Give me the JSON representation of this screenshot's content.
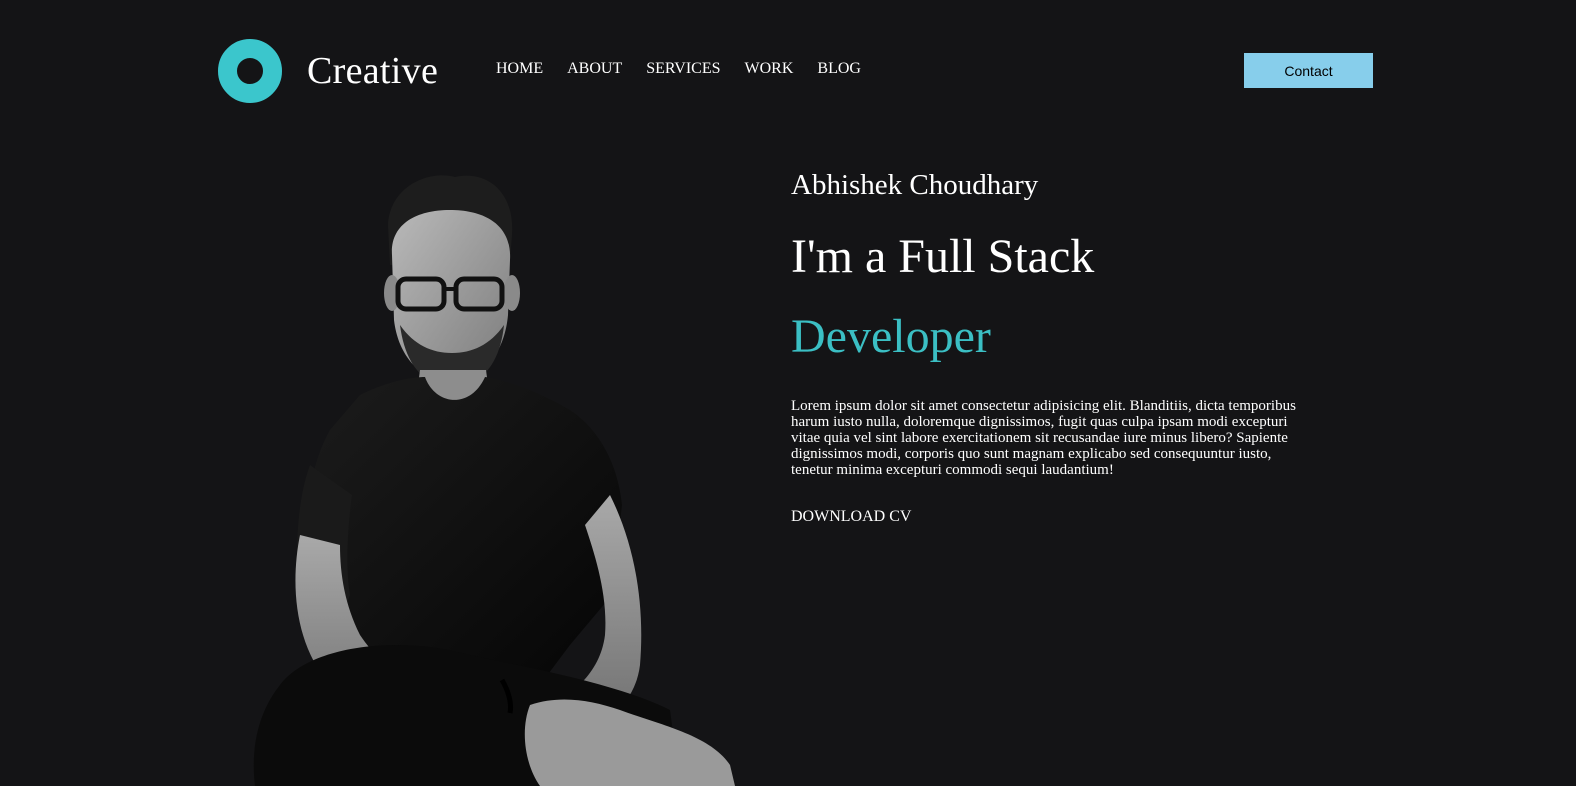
{
  "brand": {
    "name": "Creative",
    "accent_color": "#3bc6cc"
  },
  "nav": {
    "items": [
      "HOME",
      "ABOUT",
      "SERVICES",
      "WORK",
      "BLOG"
    ]
  },
  "header": {
    "contact_label": "Contact",
    "contact_color": "#87ceeb"
  },
  "hero": {
    "name": "Abhishek Choudhary",
    "title": "I'm a Full Stack",
    "role": "Developer",
    "description": "Lorem ipsum dolor sit amet consectetur adipisicing elit. Blanditiis, dicta temporibus harum iusto nulla, doloremque dignissimos, fugit quas culpa ipsam modi excepturi vitae quia vel sint labore exercitationem sit recusandae iure minus libero? Sapiente dignissimos modi, corporis quo sunt magnam explicabo sed consequuntur iusto, tenetur minima excepturi commodi sequi laudantium!",
    "download_label": "DOWNLOAD CV"
  },
  "colors": {
    "background": "#141416",
    "role_color": "#3bbfc4"
  }
}
